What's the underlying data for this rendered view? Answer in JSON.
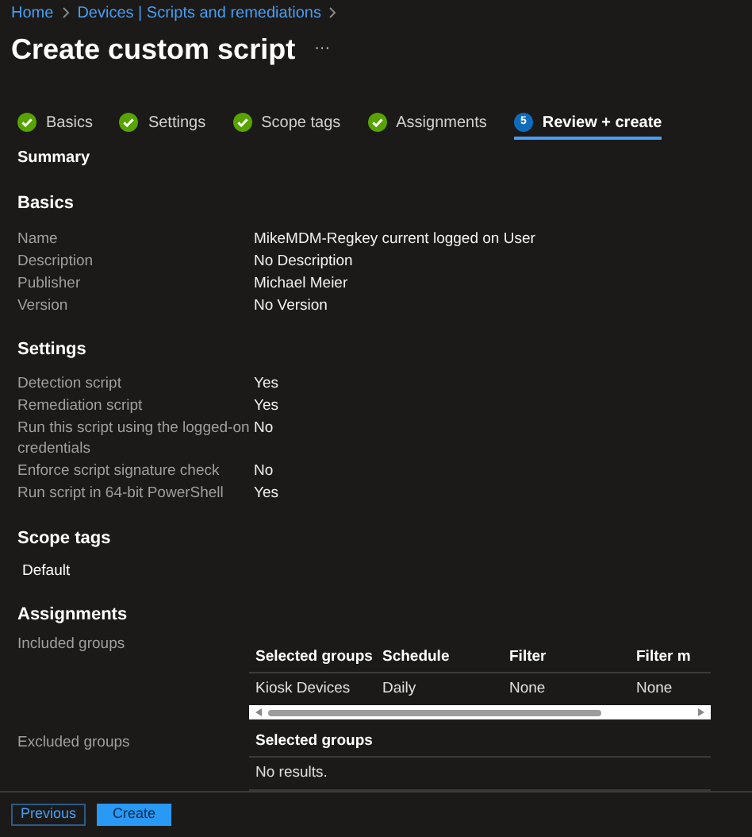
{
  "breadcrumb": [
    "Home",
    "Devices | Scripts and remediations"
  ],
  "title": "Create custom script",
  "more": "···",
  "tabs": [
    {
      "label": "Basics",
      "kind": "done",
      "selected": false
    },
    {
      "label": "Settings",
      "kind": "done",
      "selected": false
    },
    {
      "label": "Scope tags",
      "kind": "done",
      "selected": false
    },
    {
      "label": "Assignments",
      "kind": "done",
      "selected": false
    },
    {
      "label": "Review + create",
      "kind": "current",
      "step": "5",
      "selected": true
    }
  ],
  "summary": "Summary",
  "sections": [
    {
      "heading": "Basics",
      "rows": [
        {
          "label": "Name",
          "value": "MikeMDM-Regkey current logged on User"
        },
        {
          "label": "Description",
          "value": "No Description"
        },
        {
          "label": "Publisher",
          "value": "Michael Meier"
        },
        {
          "label": "Version",
          "value": "No Version"
        }
      ]
    },
    {
      "heading": "Settings",
      "rows": [
        {
          "label": "Detection script",
          "value": "Yes"
        },
        {
          "label": "Remediation script",
          "value": "Yes"
        },
        {
          "label": "Run this script using the logged-on credentials",
          "value": "No"
        },
        {
          "label": "Enforce script signature check",
          "value": "No"
        },
        {
          "label": "Run script in 64-bit PowerShell",
          "value": "Yes"
        }
      ]
    }
  ],
  "scope_tags": {
    "heading": "Scope tags",
    "items": [
      "Default"
    ]
  },
  "assignments": {
    "heading": "Assignments",
    "included": {
      "label": "Included groups",
      "columns": [
        "Selected groups",
        "Schedule",
        "Filter",
        "Filter m"
      ],
      "rows": [
        [
          "Kiosk Devices",
          "Daily",
          "None",
          "None"
        ]
      ]
    },
    "excluded": {
      "label": "Excluded groups",
      "columns": [
        "Selected groups"
      ],
      "empty": "No results."
    }
  },
  "buttons": [
    {
      "label": "Previous",
      "kind": "secondary"
    },
    {
      "label": "Create",
      "kind": "primary"
    }
  ]
}
